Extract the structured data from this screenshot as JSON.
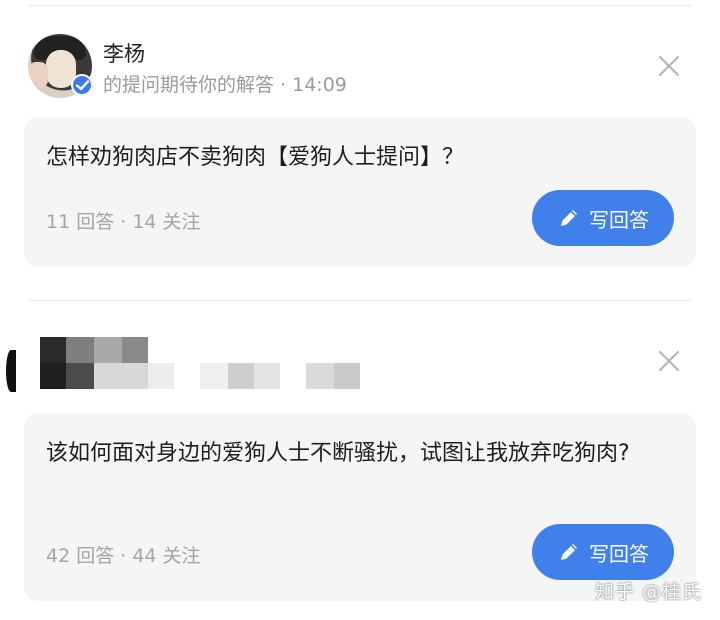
{
  "items": [
    {
      "user": {
        "name": "李杨",
        "meta": "的提问期待你的解答 · 14:09"
      },
      "question": {
        "title": "怎样劝狗肉店不卖狗肉【爱狗人士提问】？",
        "stats": "11 回答 · 14 关注"
      },
      "write_label": "写回答"
    },
    {
      "question": {
        "title": "该如何面对身边的爱狗人士不断骚扰，试图让我放弃吃狗肉?",
        "stats": "42 回答 · 44 关注"
      },
      "write_label": "写回答"
    }
  ],
  "watermark": "知乎 @桂氏",
  "colors": {
    "accent": "#3f80ea",
    "card_bg": "#f5f5f6",
    "verified": "#3a7bf0"
  }
}
